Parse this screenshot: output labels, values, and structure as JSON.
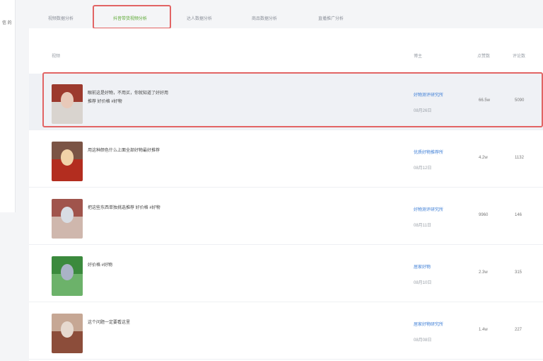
{
  "sidebar": {
    "text": "信 的"
  },
  "tabs": [
    {
      "label": "视频数据分析"
    },
    {
      "label": "抖音带货视频分析"
    },
    {
      "label": "达人数据分析"
    },
    {
      "label": "商品数据分析"
    },
    {
      "label": "直播推广分析"
    }
  ],
  "table": {
    "headers": {
      "video": "视频",
      "author": "博主",
      "views": "点赞数",
      "likes": "评论数"
    },
    "rows": [
      {
        "title": "眼前这是好物，不用买，你就知道了好好用",
        "subtitle": "推荐 好价格 #好物",
        "author": "好物测评研究所",
        "date": "08月26日",
        "views": "66.5w",
        "likes": "5090",
        "colors": [
          "#9c3a2e",
          "#d9d4cf",
          "#e8c9b9"
        ]
      },
      {
        "title": "用这种颜色什么上面全部好物最好推荐",
        "subtitle": "",
        "author": "优质好物推荐所",
        "date": "08月12日",
        "views": "4.2w",
        "likes": "1132",
        "colors": [
          "#7b5445",
          "#b32d1f",
          "#f1d2a8"
        ]
      },
      {
        "title": "把这些东西单独挑选推荐 好价格 #好物",
        "subtitle": "",
        "author": "好物测评研究所",
        "date": "08月11日",
        "views": "9960",
        "likes": "146",
        "colors": [
          "#a0544c",
          "#cfb7ad",
          "#d8dde4"
        ]
      },
      {
        "title": "好价格 #好物",
        "subtitle": "",
        "author": "居家好物",
        "date": "08月10日",
        "views": "2.3w",
        "likes": "315",
        "colors": [
          "#3b8a3d",
          "#6cb26a",
          "#aab3c7"
        ]
      },
      {
        "title": "这个问题一定要看这里",
        "subtitle": "",
        "author": "居家好物研究所",
        "date": "08月08日",
        "views": "1.4w",
        "likes": "227",
        "colors": [
          "#c6a794",
          "#8c4d3a",
          "#e6d9cf"
        ]
      }
    ]
  }
}
